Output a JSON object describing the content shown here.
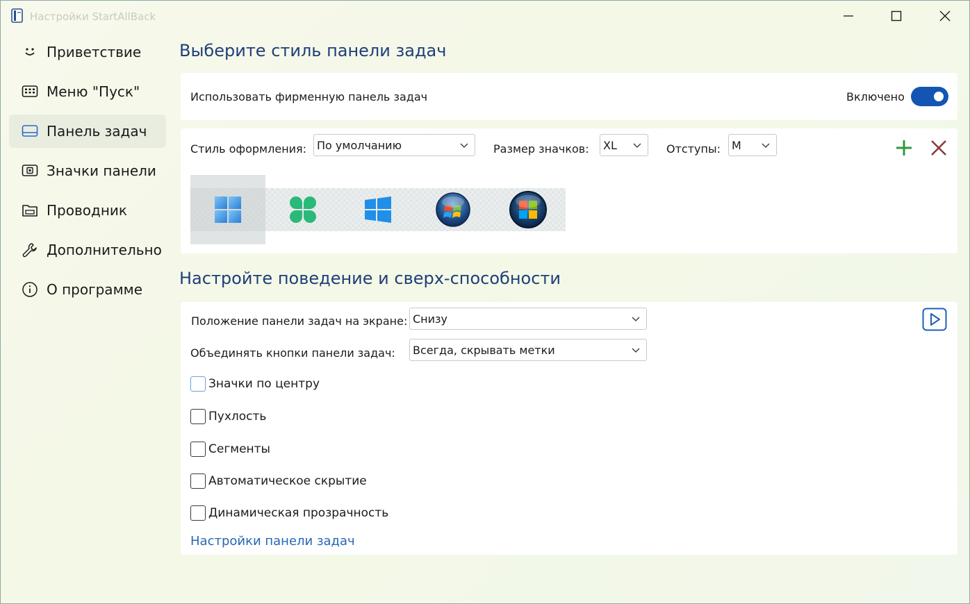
{
  "window": {
    "title": "Настройки StartAllBack"
  },
  "sidebar": {
    "items": [
      {
        "label": "Приветствие",
        "icon": "smile-icon"
      },
      {
        "label": "Меню \"Пуск\"",
        "icon": "start-menu-icon"
      },
      {
        "label": "Панель задач",
        "icon": "taskbar-icon",
        "active": true
      },
      {
        "label": "Значки панели",
        "icon": "tray-icons-icon"
      },
      {
        "label": "Проводник",
        "icon": "folder-icon"
      },
      {
        "label": "Дополнительно",
        "icon": "wrench-icon"
      },
      {
        "label": "О программе",
        "icon": "info-icon"
      }
    ]
  },
  "section1": {
    "title": "Выберите стиль панели задач",
    "use_branded_label": "Использовать фирменную панель задач",
    "toggle_state": "Включено",
    "style_label": "Стиль оформления:",
    "style_value": "По умолчанию",
    "icon_size_label": "Размер значков:",
    "icon_size_value": "XL",
    "padding_label": "Отступы:",
    "padding_value": "M",
    "add_icon": "plus-icon",
    "remove_icon": "cross-icon",
    "styles": [
      "windows11-logo",
      "clover-logo",
      "windows10-logo",
      "windows7-orb",
      "windows-vista-orb"
    ]
  },
  "section2": {
    "title": "Настройте поведение и сверх-способности",
    "position_label": "Положение панели задач на экране:",
    "position_value": "Снизу",
    "combine_label": "Объединять кнопки панели задач:",
    "combine_value": "Всегда, скрывать метки",
    "checkboxes": [
      {
        "label": "Значки по центру",
        "checked": false
      },
      {
        "label": "Пухлость",
        "checked": false
      },
      {
        "label": "Сегменты",
        "checked": false
      },
      {
        "label": "Автоматическое скрытие",
        "checked": false
      },
      {
        "label": "Динамическая прозрачность",
        "checked": false
      }
    ],
    "settings_link": "Настройки панели задач",
    "video_icon": "play-video-icon"
  },
  "colors": {
    "accent": "#1455b4",
    "heading": "#1f3f7a",
    "link": "#2667b5",
    "add": "#2e9a3a",
    "remove": "#8a3a3a"
  }
}
